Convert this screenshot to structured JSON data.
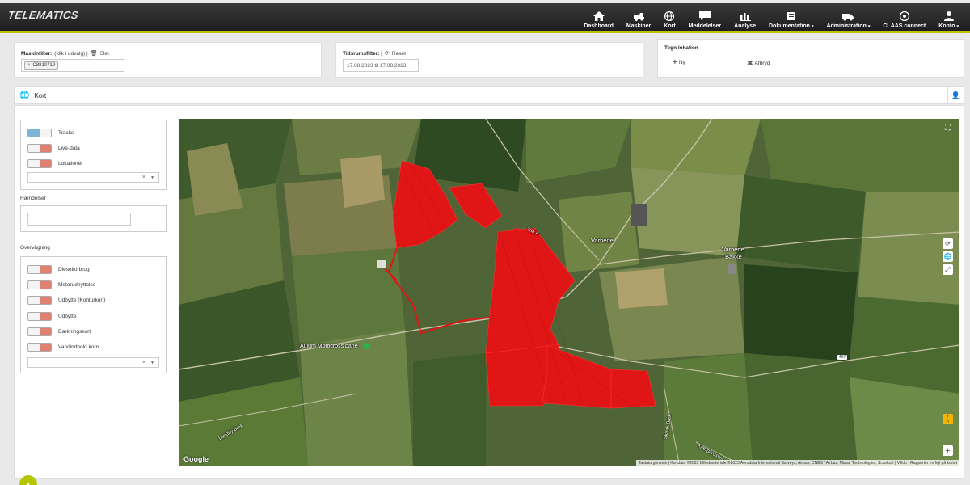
{
  "app": {
    "logo": "TELEMATICS"
  },
  "nav": [
    {
      "key": "dashboard",
      "label": "Dashboard",
      "dropdown": false
    },
    {
      "key": "maskiner",
      "label": "Maskiner",
      "dropdown": false
    },
    {
      "key": "kort",
      "label": "Kort",
      "dropdown": false
    },
    {
      "key": "meddelelser",
      "label": "Meddelelser",
      "dropdown": false
    },
    {
      "key": "analyse",
      "label": "Analyse",
      "dropdown": false
    },
    {
      "key": "dokumentation",
      "label": "Dokumentation",
      "dropdown": true
    },
    {
      "key": "administration",
      "label": "Administration",
      "dropdown": true
    },
    {
      "key": "claas",
      "label": "CLAAS connect",
      "dropdown": false
    },
    {
      "key": "konto",
      "label": "Konto",
      "dropdown": true
    }
  ],
  "filters": {
    "machine": {
      "label": "Maskinfilter:",
      "hint": "(klik i udvalg) |",
      "delete_label": "Slet",
      "chip": "C8810719"
    },
    "time": {
      "label": "Tidsrumsfilter: |",
      "reset_label": "Reset",
      "value": "17.08.2023 til 17.08.2023"
    },
    "location": {
      "label": "Tegn lokation",
      "new_label": "Ny",
      "cancel_label": "Afbryd"
    }
  },
  "kort": {
    "title": "Kort"
  },
  "layers": [
    {
      "label": "Tracks",
      "color": "#7fb4d8"
    },
    {
      "label": "Live-data",
      "color": "#e08070"
    },
    {
      "label": "Lokationer",
      "color": "#e08070"
    }
  ],
  "events": {
    "label": "Hændelser"
  },
  "monitoring": {
    "label": "Overvågning",
    "items": [
      {
        "label": "Dieselforbrug",
        "color": "#e08070"
      },
      {
        "label": "Motorudnyttelse",
        "color": "#e08070"
      },
      {
        "label": "Udbytte (Konturkort)",
        "color": "#e08070"
      },
      {
        "label": "Udbytte",
        "color": "#e08070"
      },
      {
        "label": "Dækningskort",
        "color": "#e08070"
      },
      {
        "label": "Vandindhold korn",
        "color": "#e08070"
      }
    ]
  },
  "map": {
    "labels": {
      "town1": "Varhede",
      "town2a": "Varhede",
      "town2b": "Bakke",
      "poi": "Aulum Motocross bane",
      "road1": "Trie Å",
      "road2": "Landby Bæk",
      "road3": "Skærk Bæk",
      "road4": "Kjærgårdsvej",
      "road_num": "467"
    },
    "google": "Google",
    "attribution": "Tastaturgenveje | Kortdata ©2023 Billedmateriale ©2023 Aerodata International Surveys, Airbus, CNES / Airbus, Maxar Technologies, Scankort | Vilkår | Rapporter en fejl på kortet"
  },
  "colors": {
    "accent": "#b5c500",
    "track": "#ff1a1a"
  }
}
